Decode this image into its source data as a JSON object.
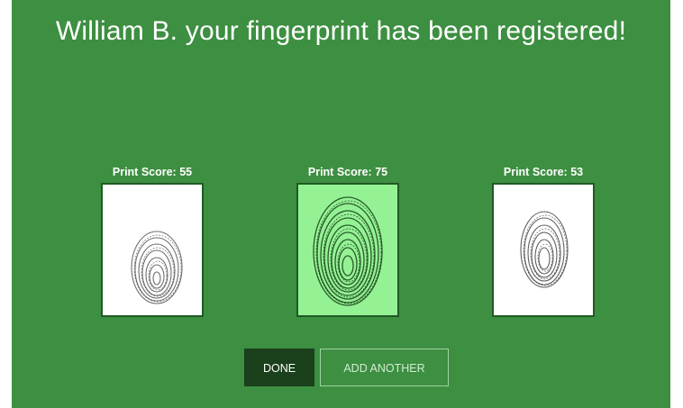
{
  "header": {
    "title": "William B. your fingerprint has been registered!"
  },
  "prints": [
    {
      "score_label": "Print Score: 55",
      "score": 55,
      "selected": false
    },
    {
      "score_label": "Print Score: 75",
      "score": 75,
      "selected": true
    },
    {
      "score_label": "Print Score: 53",
      "score": 53,
      "selected": false
    }
  ],
  "actions": {
    "done_label": "DONE",
    "add_another_label": "ADD ANOTHER"
  },
  "colors": {
    "background": "#3d8f41",
    "selected_frame": "#94f294",
    "done_button": "#1a401c"
  }
}
